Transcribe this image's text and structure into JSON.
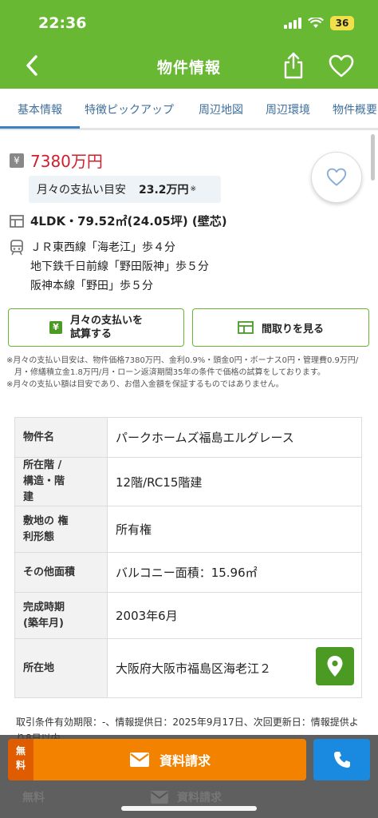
{
  "status_bar": {
    "time": "22:36",
    "battery": "36"
  },
  "nav": {
    "title": "物件情報",
    "back_icon": "chevron-left-icon",
    "share_icon": "share-icon",
    "favorite_icon": "heart-icon"
  },
  "tabs": [
    "基本情報",
    "特徴ピックアップ",
    "周辺地図",
    "周辺環境",
    "物件概要"
  ],
  "active_tab": "基本情報",
  "price": {
    "symbol": "¥",
    "value": "7380万円"
  },
  "monthly": {
    "label": "月々の支払い目安",
    "value": "23.2万円",
    "note": "※"
  },
  "layout": "4LDK・79.52㎡(24.05坪) (壁芯)",
  "access": [
    "ＪＲ東西線「海老江」歩４分",
    "地下鉄千日前線「野田阪神」歩５分",
    "阪神本線「野田」歩５分"
  ],
  "buttons": {
    "calc_line1": "月々の支払いを",
    "calc_line2": "試算する",
    "floorplan": "間取りを見る"
  },
  "notes": [
    "※月々の支払い目安は、物件価格7380万円、金利0.9%・頭金0円・ボーナス0円・管理費0.9万円/月・修繕積立金1.8万円/月・ローン返済期間35年の条件で価格の試算をしております。",
    "※月々の支払い額は目安であり、お借入金額を保証するものではありません。"
  ],
  "table": [
    {
      "label": "物件名",
      "value": "パークホームズ福島エルグレース"
    },
    {
      "label": "所在階 / 構造・階建",
      "value": "12階/RC15階建"
    },
    {
      "label": "敷地の 権利形態",
      "value": "所有権"
    },
    {
      "label": "その他面積",
      "value": "バルコニー面積：15.96㎡"
    },
    {
      "label": "完成時期 (築年月)",
      "value": "2003年6月"
    },
    {
      "label": "所在地",
      "value": "大阪府大阪市福島区海老江２"
    }
  ],
  "footer_text": "取引条件有効期限：-、情報提供日：2025年9月17日、次回更新日：情報提供より8日以内",
  "bottom": {
    "free_label": "無料",
    "request_label": "資料請求"
  },
  "colors": {
    "header_green": "#68b834",
    "price_red": "#d0202e",
    "request_orange": "#f28200",
    "phone_blue": "#1a8ae0"
  }
}
